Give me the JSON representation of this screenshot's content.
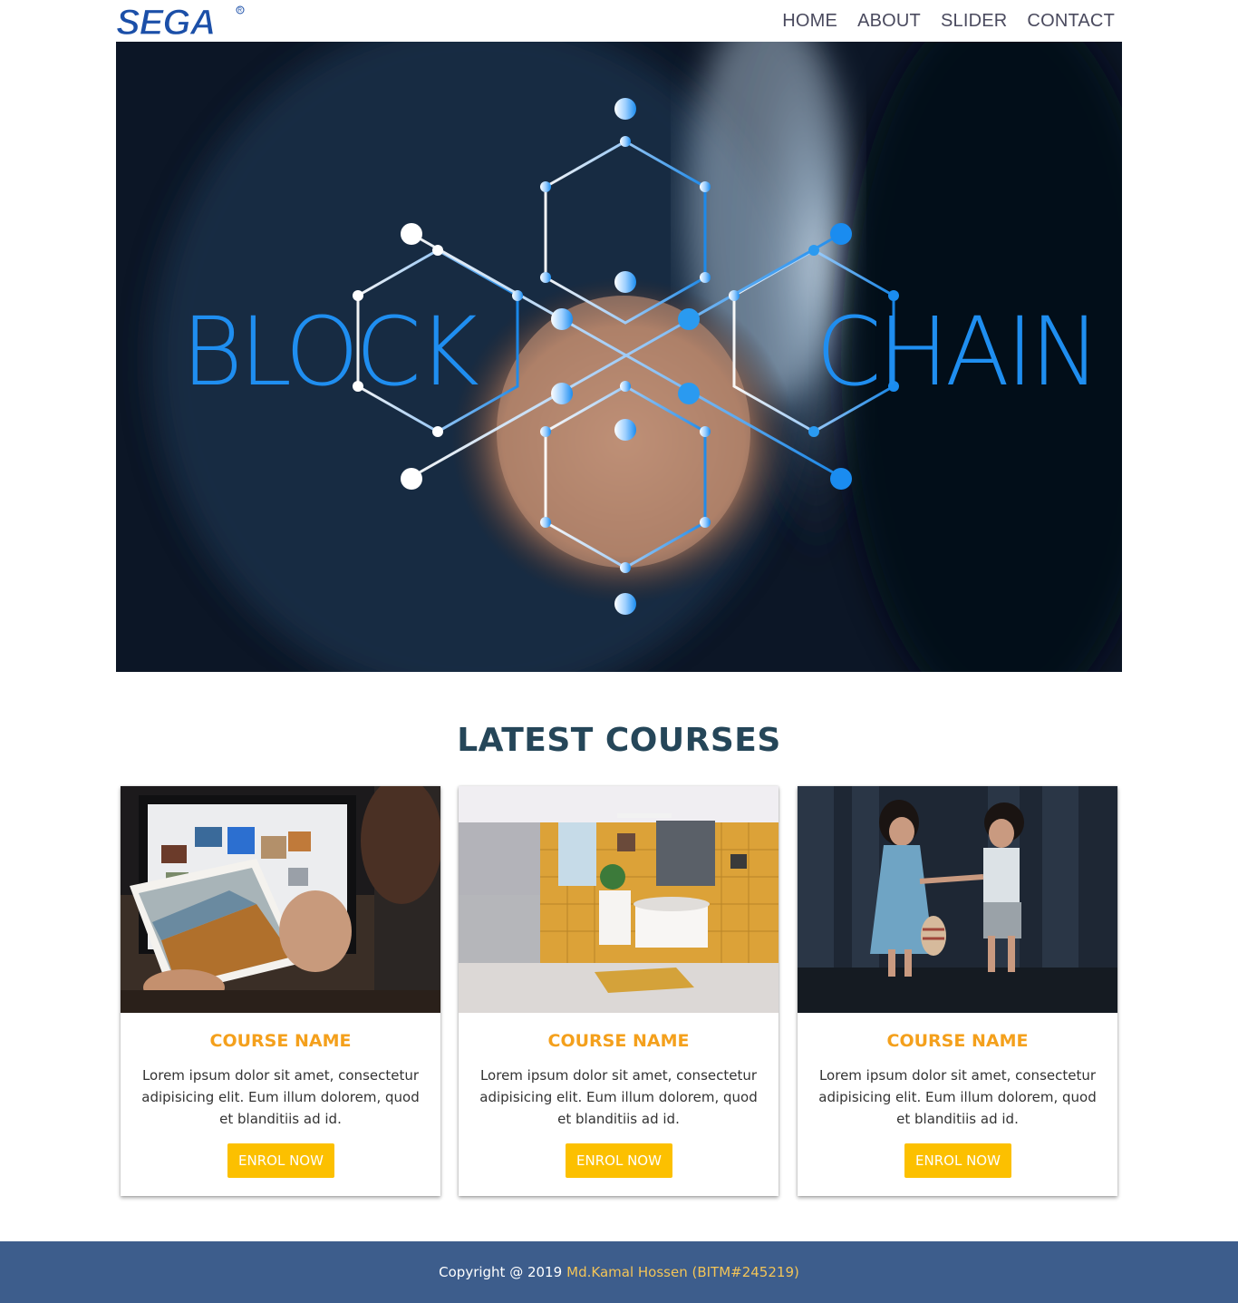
{
  "brand": {
    "logo_text": "SEGA",
    "logo_color": "#1b4fa8"
  },
  "nav": {
    "items": [
      {
        "label": "HOME"
      },
      {
        "label": "ABOUT"
      },
      {
        "label": "SLIDER"
      },
      {
        "label": "CONTACT"
      }
    ]
  },
  "hero": {
    "word_left": "BLOCK",
    "word_right": "CHAIN",
    "accent_color": "#1f8ef0"
  },
  "courses": {
    "title": "LATEST COURSES",
    "cards": [
      {
        "title": "COURSE NAME",
        "text": "Lorem ipsum dolor sit amet, consectetur adipisicing elit. Eum illum dolorem, quod et blanditiis ad id.",
        "button": "ENROL NOW",
        "image_icon": "photo-editing-image"
      },
      {
        "title": "COURSE NAME",
        "text": "Lorem ipsum dolor sit amet, consectetur adipisicing elit. Eum illum dolorem, quod et blanditiis ad id.",
        "button": "ENROL NOW",
        "image_icon": "bathroom-image"
      },
      {
        "title": "COURSE NAME",
        "text": "Lorem ipsum dolor sit amet, consectetur adipisicing elit. Eum illum dolorem, quod et blanditiis ad id.",
        "button": "ENROL NOW",
        "image_icon": "children-image"
      }
    ]
  },
  "footer": {
    "copyright": "Copyright @ 2019",
    "author": "Md.Kamal Hossen (BITM#245219)"
  },
  "colors": {
    "title": "#254659",
    "card_title": "#f4a01c",
    "button": "#fcc000",
    "footer_bg": "#3d5d8c",
    "footer_author": "#f2c458"
  }
}
